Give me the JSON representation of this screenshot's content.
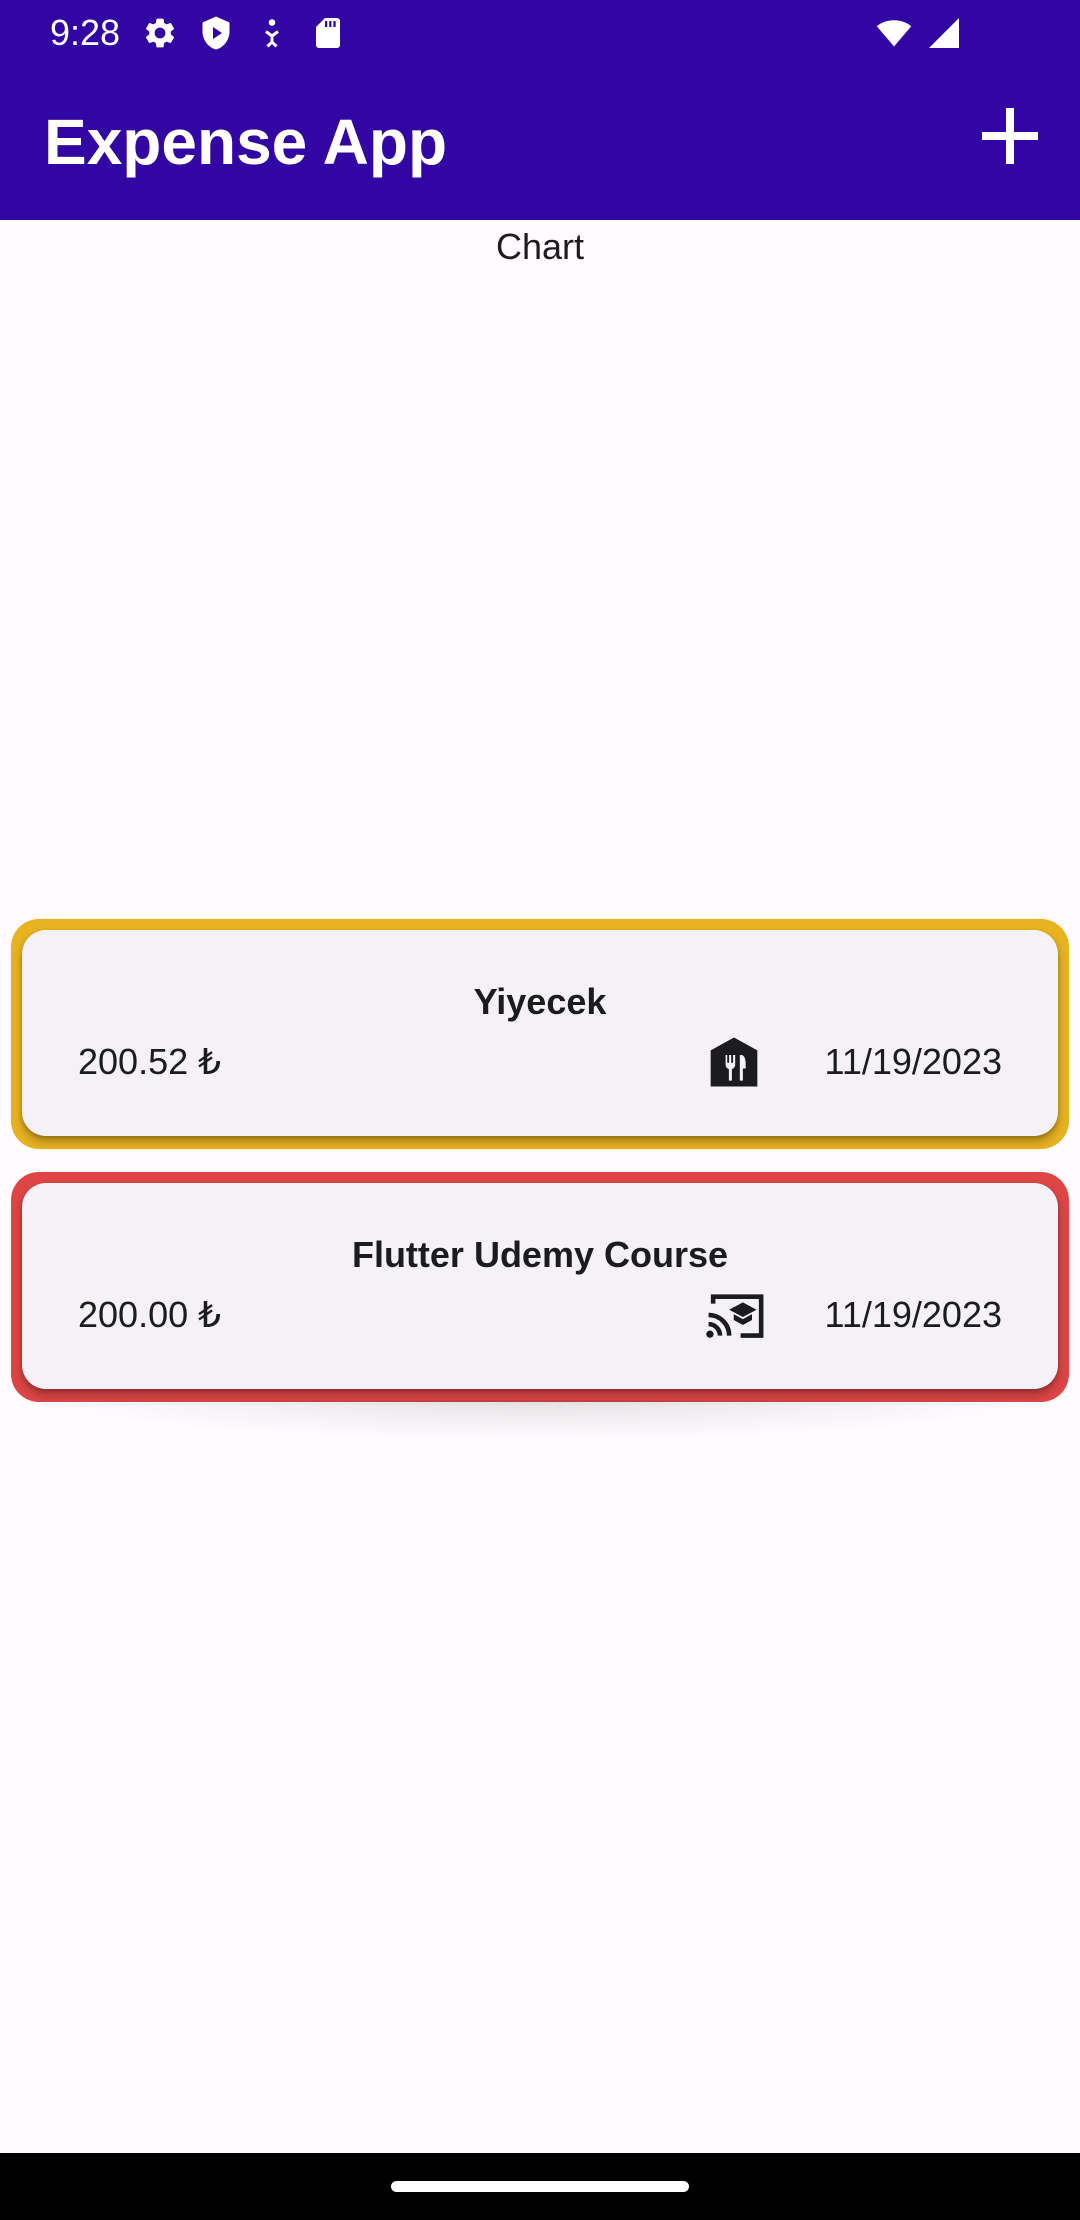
{
  "status_bar": {
    "time": "9:28",
    "left_icons": [
      "gear-icon",
      "shield-play-icon",
      "accessibility-icon",
      "sd-card-icon"
    ],
    "right_icons": [
      "wifi-icon",
      "cell-signal-icon"
    ]
  },
  "app_bar": {
    "title": "Expense App",
    "add_icon": "plus-icon"
  },
  "chart": {
    "label": "Chart"
  },
  "expenses": [
    {
      "title": "Yiyecek",
      "amount": "200.52 ₺",
      "date": "11/19/2023",
      "category_icon": "restaurant-icon",
      "accent_color": "#e8b321"
    },
    {
      "title": "Flutter Udemy Course",
      "amount": "200.00 ₺",
      "date": "11/19/2023",
      "category_icon": "cast-for-education-icon",
      "accent_color": "#de4646"
    }
  ],
  "colors": {
    "primary": "#3106a2",
    "background": "#fffbfe",
    "card": "#f4f1f7"
  }
}
